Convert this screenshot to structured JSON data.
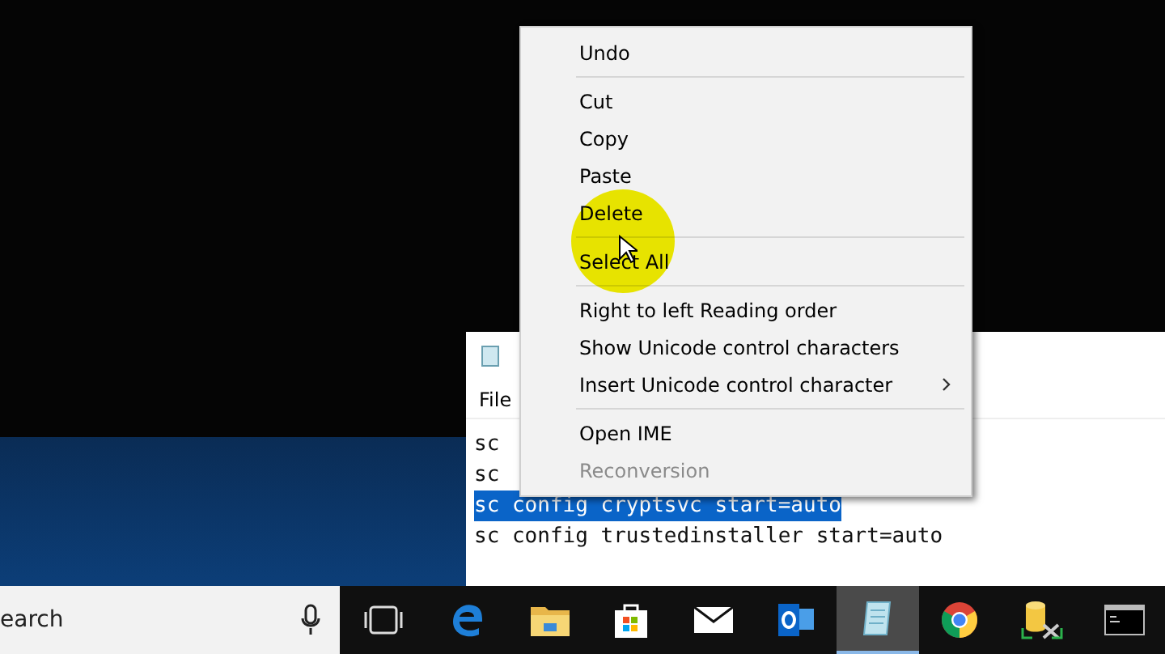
{
  "notepad": {
    "menu": [
      "File"
    ],
    "lines": [
      {
        "text": "sc",
        "selected": false
      },
      {
        "text": "sc",
        "selected": false
      },
      {
        "text": "sc config cryptsvc start=auto",
        "selected": true
      },
      {
        "text": "sc config trustedinstaller start=auto",
        "selected": false
      }
    ]
  },
  "context_menu": {
    "items": [
      {
        "kind": "item",
        "label": "Undo",
        "disabled": false
      },
      {
        "kind": "separator"
      },
      {
        "kind": "item",
        "label": "Cut",
        "disabled": false
      },
      {
        "kind": "item",
        "label": "Copy",
        "disabled": false
      },
      {
        "kind": "item",
        "label": "Paste",
        "disabled": false
      },
      {
        "kind": "item",
        "label": "Delete",
        "disabled": false
      },
      {
        "kind": "separator"
      },
      {
        "kind": "item",
        "label": "Select All",
        "disabled": false
      },
      {
        "kind": "separator"
      },
      {
        "kind": "item",
        "label": "Right to left Reading order",
        "disabled": false
      },
      {
        "kind": "item",
        "label": "Show Unicode control characters",
        "disabled": false
      },
      {
        "kind": "submenu",
        "label": "Insert Unicode control character",
        "disabled": false
      },
      {
        "kind": "separator"
      },
      {
        "kind": "item",
        "label": "Open IME",
        "disabled": false
      },
      {
        "kind": "item",
        "label": "Reconversion",
        "disabled": true
      }
    ]
  },
  "taskbar": {
    "search_placeholder": "earch",
    "apps": [
      {
        "kind": "taskview",
        "selected": false
      },
      {
        "kind": "edge",
        "selected": false
      },
      {
        "kind": "explorer",
        "selected": false
      },
      {
        "kind": "store",
        "selected": false
      },
      {
        "kind": "mail",
        "selected": false
      },
      {
        "kind": "outlook",
        "selected": false
      },
      {
        "kind": "notepad",
        "selected": true
      },
      {
        "kind": "chrome",
        "selected": false
      },
      {
        "kind": "database",
        "selected": false
      },
      {
        "kind": "cmd",
        "selected": false
      }
    ]
  }
}
